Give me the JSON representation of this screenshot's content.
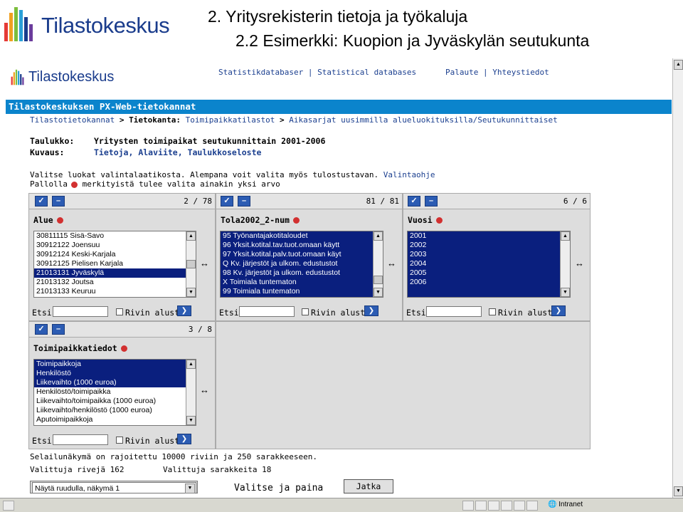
{
  "slide": {
    "logo_text": "Tilastokeskus",
    "title": "2. Yritysrekisterin tietoja ja työkaluja",
    "subtitle": "2.2 Esimerkki: Kuopion ja Jyväskylän seutukunta"
  },
  "page": {
    "logo_text": "Tilastokeskus",
    "top_links": [
      "Statistikdatabaser",
      "|",
      "Statistical databases",
      "Palaute",
      "|",
      "Yhteystiedot"
    ],
    "banner": "Tilastokeskuksen PX-Web-tietokannat",
    "breadcrumb": {
      "l1": "Tilastotietokannat",
      "sep1": ">",
      "l2_label": "Tietokanta:",
      "l2": "Toimipaikkatilastot",
      "sep2": ">",
      "l3": "Aikasarjat uusimmilla alueluokituksilla/Seutukunnittaiset"
    },
    "table_label": "Taulukko:",
    "table_value": "Yritysten toimipaikat seutukunnittain 2001-2006",
    "desc_label": "Kuvaus:",
    "desc_links": [
      "Tietoja",
      "Alaviite",
      "Taulukkoseloste"
    ],
    "instr1": "Valitse luokat valintalaatikosta. Alempana voit valita myös tulostustavan.",
    "instr_link": "Valintaohje",
    "instr2": "Pallolla",
    "instr3": "merkityistä tulee valita ainakin yksi arvo"
  },
  "panels": {
    "alue": {
      "count": "2 / 78",
      "title": "Alue",
      "items": [
        "30811115 Sisä-Savo",
        "30912122 Joensuu",
        "30912124 Keski-Karjala",
        "30912125 Pielisen Karjala",
        "21013131 Jyväskylä",
        "21013132 Joutsa",
        "21013133 Keuruu"
      ],
      "selected": [
        4
      ]
    },
    "tola": {
      "count": "81 / 81",
      "title": "Tola2002_2-num",
      "items": [
        "95 Työnantajakotitaloudet",
        "96 Yksit.kotital.tav.tuot.omaan käytt",
        "97 Yksit.kotital.palv.tuot.omaan käyt",
        "Q Kv. järjestöt ja ulkom. edustustot",
        "98 Kv. järjestöt ja ulkom. edustustot",
        "X Toimiala tuntematon",
        "99 Toimiala tuntematon"
      ],
      "selected": [
        0,
        1,
        2,
        3,
        4,
        5,
        6
      ]
    },
    "vuosi": {
      "count": "6 / 6",
      "title": "Vuosi",
      "items": [
        "2001",
        "2002",
        "2003",
        "2004",
        "2005",
        "2006"
      ],
      "selected": [
        0,
        1,
        2,
        3,
        4,
        5
      ]
    },
    "tiedot": {
      "count": "3 / 8",
      "title": "Toimipaikkatiedot",
      "items": [
        "Toimipaikkoja",
        "Henkilöstö",
        "Liikevaihto (1000 euroa)",
        "Henkilöstö/toimipaikka",
        "Liikevaihto/toimipaikka (1000 euroa)",
        "Liikevaihto/henkilöstö (1000 euroa)",
        "Aputoimipaikkoja"
      ],
      "selected": [
        0,
        1,
        2
      ]
    }
  },
  "controls": {
    "etsi": "Etsi",
    "rivin_alusta": "Rivin alusta",
    "check_all": "✓",
    "uncheck": "–",
    "go": "❯",
    "swap": "↔"
  },
  "footer": {
    "limit": "Selailunäkymä on rajoitettu 10000 riviin ja 250 sarakkeeseen.",
    "rows": "Valittuja rivejä 162",
    "cols": "Valittuja sarakkeita 18",
    "view_select": "Näytä ruudulla, näkymä 1",
    "choose": "Valitse ja paina",
    "continue": "Jatka"
  },
  "status": {
    "zone": "Intranet"
  },
  "colors": {
    "banner": "#0b84cc",
    "selection": "#0a1f7e",
    "link": "#1b3f8f",
    "logo": "#1a3c8c"
  }
}
